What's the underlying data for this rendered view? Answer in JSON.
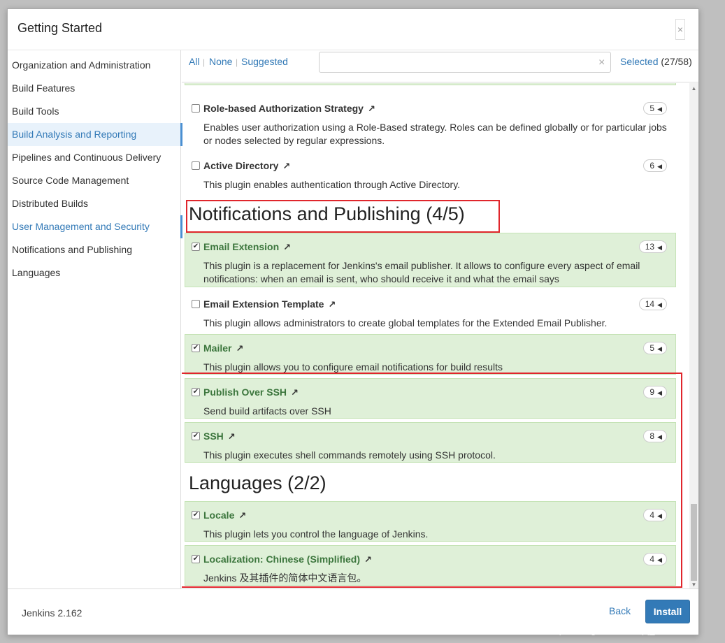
{
  "dialog": {
    "title": "Getting Started",
    "close_label": "×"
  },
  "sidebar": {
    "items": [
      {
        "label": "Organization and Administration"
      },
      {
        "label": "Build Features"
      },
      {
        "label": "Build Tools"
      },
      {
        "label": "Build Analysis and Reporting"
      },
      {
        "label": "Pipelines and Continuous Delivery"
      },
      {
        "label": "Source Code Management"
      },
      {
        "label": "Distributed Builds"
      },
      {
        "label": "User Management and Security"
      },
      {
        "label": "Notifications and Publishing"
      },
      {
        "label": "Languages"
      }
    ]
  },
  "filter": {
    "all": "All",
    "none": "None",
    "suggested": "Suggested",
    "sep": "|",
    "search_value": "",
    "clear": "×",
    "selected_label": "Selected",
    "selected_count": "(27/58)"
  },
  "plugins": {
    "role": {
      "name": "Role-based Authorization Strategy",
      "count": "5",
      "desc": "Enables user authorization using a Role-Based strategy. Roles can be defined globally or for particular jobs or nodes selected by regular expressions."
    },
    "ad": {
      "name": "Active Directory",
      "count": "6",
      "desc": "This plugin enables authentication through Active Directory."
    },
    "email_ext": {
      "name": "Email Extension",
      "count": "13",
      "desc": "This plugin is a replacement for Jenkins's email publisher. It allows to configure every aspect of email notifications: when an email is sent, who should receive it and what the email says"
    },
    "email_tpl": {
      "name": "Email Extension Template",
      "count": "14",
      "desc": "This plugin allows administrators to create global templates for the Extended Email Publisher."
    },
    "mailer": {
      "name": "Mailer",
      "count": "5",
      "desc": "This plugin allows you to configure email notifications for build results"
    },
    "pub_ssh": {
      "name": "Publish Over SSH",
      "count": "9",
      "desc": "Send build artifacts over SSH"
    },
    "ssh": {
      "name": "SSH",
      "count": "8",
      "desc": "This plugin executes shell commands remotely using SSH protocol."
    },
    "locale": {
      "name": "Locale",
      "count": "4",
      "desc": "This plugin lets you control the language of Jenkins."
    },
    "l10n_zh": {
      "name": "Localization: Chinese (Simplified)",
      "count": "4",
      "desc": "Jenkins 及其插件的简体中文语言包。"
    }
  },
  "sections": {
    "notifications": "Notifications and Publishing (4/5)",
    "languages": "Languages (2/2)"
  },
  "icons": {
    "check": "✔",
    "external": "↗",
    "badge_arrow": "◀",
    "scroll_up": "▲",
    "scroll_down": "▼"
  },
  "footer": {
    "version": "Jenkins 2.162",
    "back": "Back",
    "install": "Install"
  },
  "watermark": "https://blog.csdn.net/qq_43670734",
  "colors": {
    "accent": "#337ab7",
    "checked_bg": "#dff0d8",
    "annotation_red": "#e0262c"
  }
}
